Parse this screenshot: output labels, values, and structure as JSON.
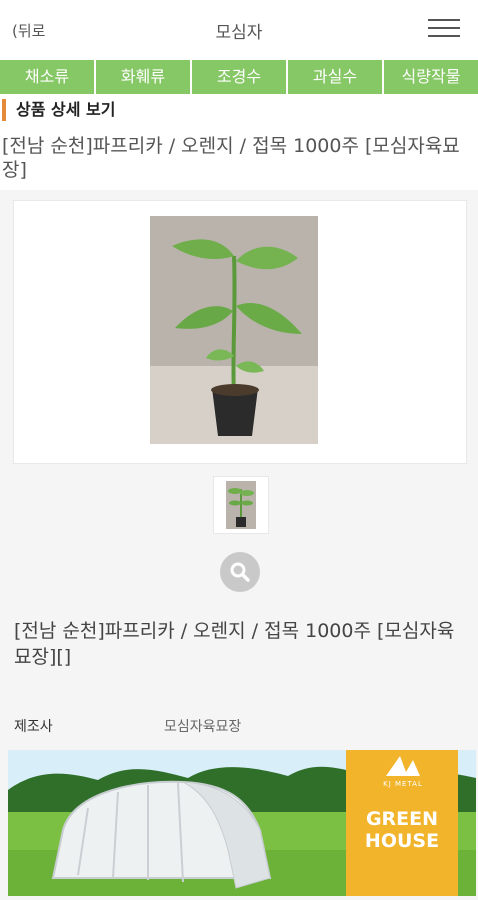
{
  "header": {
    "back_label": "(뒤로",
    "title": "모심자",
    "menu_icon": "hamburger-menu-icon"
  },
  "categories": [
    "채소류",
    "화훼류",
    "조경수",
    "과실수",
    "식량작물"
  ],
  "section": {
    "title": "상품 상세 보기"
  },
  "product": {
    "name": "[전남 순천]파프리카 / 오렌지 / 접목 1000주 [모심자육묘장]",
    "detail_name": "[전남 순천]파프리카 / 오렌지 / 접목 1000주 [모심자육묘장][]"
  },
  "info": {
    "maker_label": "제조사",
    "maker_value": "모심자육묘장"
  },
  "banner": {
    "brand": "KJ METAL",
    "line1": "GREEN",
    "line2": "HOUSE"
  },
  "colors": {
    "category_bg": "#86c766",
    "accent": "#e5893a",
    "banner_yellow": "#f2b42b"
  },
  "icons": {
    "zoom": "search-icon"
  }
}
